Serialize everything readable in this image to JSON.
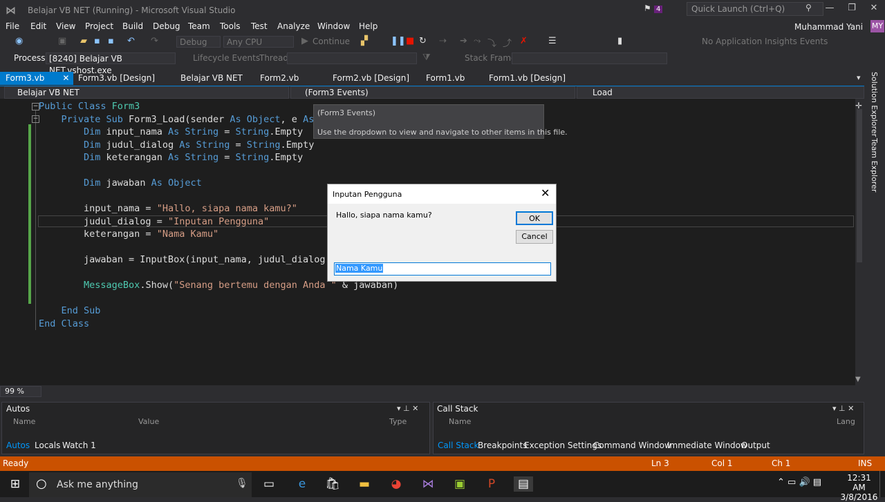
{
  "window": {
    "title": "Belajar VB NET (Running) - Microsoft Visual Studio",
    "notif_count": "4",
    "quick_launch_placeholder": "Quick Launch (Ctrl+Q)",
    "user_name": "Muhammad Yani",
    "user_initials": "MY"
  },
  "menu": [
    "File",
    "Edit",
    "View",
    "Project",
    "Build",
    "Debug",
    "Team",
    "Tools",
    "Test",
    "Analyze",
    "Window",
    "Help"
  ],
  "toolbar": {
    "config": "Debug",
    "platform": "Any CPU",
    "continue": "Continue",
    "insights": "No Application Insights Events"
  },
  "debug_bar": {
    "process_label": "Process:",
    "process": "[8240] Belajar VB NET.vshost.exe",
    "lifecycle": "Lifecycle Events",
    "thread_label": "Thread:",
    "stackframe_label": "Stack Frame:"
  },
  "tabs": [
    "Form3.vb",
    "Form3.vb [Design]",
    "Belajar VB NET",
    "Form2.vb",
    "Form2.vb [Design]",
    "Form1.vb",
    "Form1.vb [Design]"
  ],
  "navbar": {
    "project": "Belajar VB NET",
    "object": "(Form3 Events)",
    "member": "Load"
  },
  "tooltip": {
    "title": "(Form3 Events)",
    "body": "Use the dropdown to view and navigate to other items in this file."
  },
  "code": {
    "l1a": "Public Class ",
    "l1b": "Form3",
    "l2a": "    Private Sub ",
    "l2b": "Form3_Load(sender ",
    "l2c": "As",
    "l2d": " ",
    "l2e": "Object",
    "l2f": ", e ",
    "l2g": "As",
    "l3a": "        Dim ",
    "l3b": "input_nama ",
    "l3c": "As",
    "l3d": " ",
    "l3e": "String",
    "l3f": " = ",
    "l3g": "String",
    "l3h": ".Empty",
    "l4a": "        Dim ",
    "l4b": "judul_dialog ",
    "l4c": "As",
    "l4d": " ",
    "l4e": "String",
    "l4f": " = ",
    "l4g": "String",
    "l4h": ".Empty",
    "l5a": "        Dim ",
    "l5b": "keterangan ",
    "l5c": "As",
    "l5d": " ",
    "l5e": "String",
    "l5f": " = ",
    "l5g": "String",
    "l5h": ".Empty",
    "l7a": "        Dim ",
    "l7b": "jawaban ",
    "l7c": "As",
    "l7d": " ",
    "l7e": "Object",
    "l9a": "        input_nama = ",
    "l9b": "\"Hallo, siapa nama kamu?\"",
    "l10a": "        judul_dialog = ",
    "l10b": "\"Inputan Pengguna\"",
    "l11a": "        keterangan = ",
    "l11b": "\"Nama Kamu\"",
    "l13": "        jawaban = InputBox(input_nama, judul_dialog",
    "l15a": "        ",
    "l15b": "MessageBox",
    "l15c": ".Show(",
    "l15d": "\"Senang bertemu dengan Anda \"",
    "l15e": " & jawaban)",
    "l17": "    End Sub",
    "l18": "End Class"
  },
  "dialog": {
    "title": "Inputan Pengguna",
    "prompt": "Hallo, siapa nama kamu?",
    "ok": "OK",
    "cancel": "Cancel",
    "input_value": "Nama Kamu"
  },
  "zoom": "99 %",
  "autos": {
    "title": "Autos",
    "col_name": "Name",
    "col_value": "Value",
    "col_type": "Type",
    "tabs": [
      "Autos",
      "Locals",
      "Watch 1"
    ]
  },
  "callstack": {
    "title": "Call Stack",
    "col_name": "Name",
    "col_lang": "Lang",
    "tabs": [
      "Call Stack",
      "Breakpoints",
      "Exception Settings",
      "Command Window",
      "Immediate Window",
      "Output"
    ]
  },
  "sidebar": {
    "solution_explorer": "Solution Explorer",
    "team_explorer": "Team Explorer"
  },
  "status": {
    "ready": "Ready",
    "line": "Ln 3",
    "col": "Col 1",
    "ch": "Ch 1",
    "mode": "INS"
  },
  "taskbar": {
    "search": "Ask me anything",
    "time": "12:31 AM",
    "date": "3/8/2016"
  },
  "colors": {
    "accent": "#007acc",
    "status": "#ca5100",
    "keyword": "#569cd6",
    "string": "#d69d85",
    "type": "#4ec9b0"
  }
}
